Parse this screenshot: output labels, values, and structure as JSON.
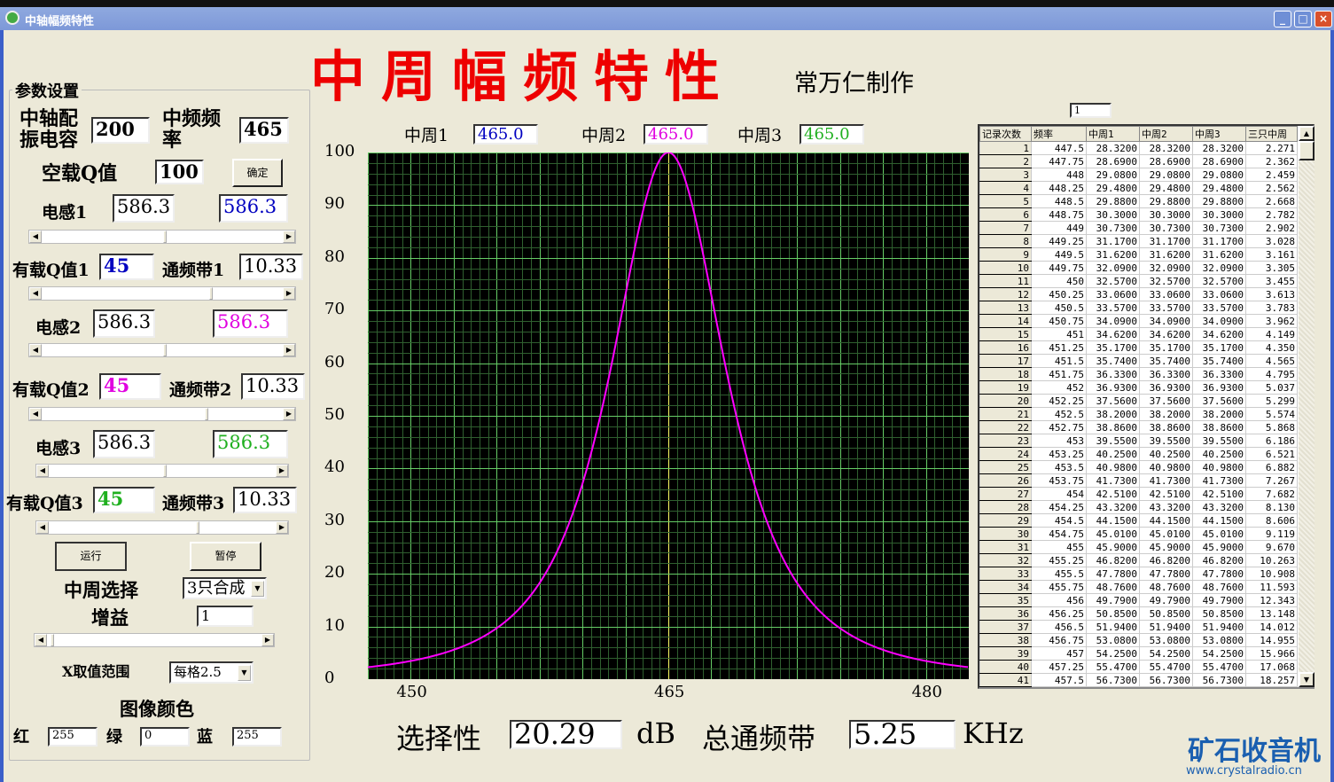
{
  "window": {
    "title": "中轴幅频特性",
    "minimize": "_",
    "maximize": "□",
    "close": "×"
  },
  "header": {
    "title": "中周幅频特性",
    "author": "常万仁制作"
  },
  "params": {
    "group_title": "参数设置",
    "cap_label": "中轴配振电容",
    "cap_value": "200",
    "if_label": "中频频率",
    "if_value": "465",
    "q0_label": "空载Q值",
    "q0_value": "100",
    "confirm_button": "确定",
    "stages": [
      {
        "l_label": "电感1",
        "l_value": "586.3",
        "l_value2": "586.3",
        "q_label": "有载Q值1",
        "q_value": "45",
        "bw_label": "通频带1",
        "bw_value": "10.33",
        "color": "#0000c0"
      },
      {
        "l_label": "电感2",
        "l_value": "586.3",
        "l_value2": "586.3",
        "q_label": "有载Q值2",
        "q_value": "45",
        "bw_label": "通频带2",
        "bw_value": "10.33",
        "color": "#e000e0"
      },
      {
        "l_label": "电感3",
        "l_value": "586.3",
        "l_value2": "586.3",
        "q_label": "有载Q值3",
        "q_value": "45",
        "bw_label": "通频带3",
        "bw_value": "10.33",
        "color": "#20b020"
      }
    ],
    "run_button": "运行",
    "pause_button": "暂停",
    "select_label": "中周选择",
    "select_value": "3只合成",
    "gain_label": "增益",
    "gain_value": "1",
    "xrange_label": "X取值范围",
    "xrange_value": "每格2.5",
    "color_label": "图像颜色",
    "red_label": "红",
    "red_value": "255",
    "green_label": "绿",
    "green_value": "0",
    "blue_label": "蓝",
    "blue_value": "255"
  },
  "chart_header": [
    {
      "label": "中周1",
      "value": "465.0",
      "color": "#0000c0"
    },
    {
      "label": "中周2",
      "value": "465.0",
      "color": "#e000e0"
    },
    {
      "label": "中周3",
      "value": "465.0",
      "color": "#20b020"
    }
  ],
  "chart_data": {
    "type": "line",
    "title": "",
    "xlabel": "",
    "ylabel": "",
    "xlim": [
      447.5,
      482.5
    ],
    "ylim": [
      0,
      100
    ],
    "xticks": [
      "450",
      "465",
      "480"
    ],
    "xtick_values": [
      450,
      465,
      480
    ],
    "yticks": [
      "100",
      "90",
      "80",
      "70",
      "60",
      "50",
      "40",
      "30",
      "20",
      "10",
      "0"
    ],
    "grid": true,
    "series": [
      {
        "name": "三只中周",
        "color": "#ff00ff",
        "model": "3-stage resonance",
        "f0": 465,
        "q": 45,
        "stages": 3
      }
    ]
  },
  "record_box": "1",
  "table": {
    "headers": [
      "记录次数",
      "频率",
      "中周1",
      "中周2",
      "中周3",
      "三只中周"
    ],
    "rows": [
      [
        "1",
        "447.5",
        "28.3200",
        "28.3200",
        "28.3200",
        "2.271"
      ],
      [
        "2",
        "447.75",
        "28.6900",
        "28.6900",
        "28.6900",
        "2.362"
      ],
      [
        "3",
        "448",
        "29.0800",
        "29.0800",
        "29.0800",
        "2.459"
      ],
      [
        "4",
        "448.25",
        "29.4800",
        "29.4800",
        "29.4800",
        "2.562"
      ],
      [
        "5",
        "448.5",
        "29.8800",
        "29.8800",
        "29.8800",
        "2.668"
      ],
      [
        "6",
        "448.75",
        "30.3000",
        "30.3000",
        "30.3000",
        "2.782"
      ],
      [
        "7",
        "449",
        "30.7300",
        "30.7300",
        "30.7300",
        "2.902"
      ],
      [
        "8",
        "449.25",
        "31.1700",
        "31.1700",
        "31.1700",
        "3.028"
      ],
      [
        "9",
        "449.5",
        "31.6200",
        "31.6200",
        "31.6200",
        "3.161"
      ],
      [
        "10",
        "449.75",
        "32.0900",
        "32.0900",
        "32.0900",
        "3.305"
      ],
      [
        "11",
        "450",
        "32.5700",
        "32.5700",
        "32.5700",
        "3.455"
      ],
      [
        "12",
        "450.25",
        "33.0600",
        "33.0600",
        "33.0600",
        "3.613"
      ],
      [
        "13",
        "450.5",
        "33.5700",
        "33.5700",
        "33.5700",
        "3.783"
      ],
      [
        "14",
        "450.75",
        "34.0900",
        "34.0900",
        "34.0900",
        "3.962"
      ],
      [
        "15",
        "451",
        "34.6200",
        "34.6200",
        "34.6200",
        "4.149"
      ],
      [
        "16",
        "451.25",
        "35.1700",
        "35.1700",
        "35.1700",
        "4.350"
      ],
      [
        "17",
        "451.5",
        "35.7400",
        "35.7400",
        "35.7400",
        "4.565"
      ],
      [
        "18",
        "451.75",
        "36.3300",
        "36.3300",
        "36.3300",
        "4.795"
      ],
      [
        "19",
        "452",
        "36.9300",
        "36.9300",
        "36.9300",
        "5.037"
      ],
      [
        "20",
        "452.25",
        "37.5600",
        "37.5600",
        "37.5600",
        "5.299"
      ],
      [
        "21",
        "452.5",
        "38.2000",
        "38.2000",
        "38.2000",
        "5.574"
      ],
      [
        "22",
        "452.75",
        "38.8600",
        "38.8600",
        "38.8600",
        "5.868"
      ],
      [
        "23",
        "453",
        "39.5500",
        "39.5500",
        "39.5500",
        "6.186"
      ],
      [
        "24",
        "453.25",
        "40.2500",
        "40.2500",
        "40.2500",
        "6.521"
      ],
      [
        "25",
        "453.5",
        "40.9800",
        "40.9800",
        "40.9800",
        "6.882"
      ],
      [
        "26",
        "453.75",
        "41.7300",
        "41.7300",
        "41.7300",
        "7.267"
      ],
      [
        "27",
        "454",
        "42.5100",
        "42.5100",
        "42.5100",
        "7.682"
      ],
      [
        "28",
        "454.25",
        "43.3200",
        "43.3200",
        "43.3200",
        "8.130"
      ],
      [
        "29",
        "454.5",
        "44.1500",
        "44.1500",
        "44.1500",
        "8.606"
      ],
      [
        "30",
        "454.75",
        "45.0100",
        "45.0100",
        "45.0100",
        "9.119"
      ],
      [
        "31",
        "455",
        "45.9000",
        "45.9000",
        "45.9000",
        "9.670"
      ],
      [
        "32",
        "455.25",
        "46.8200",
        "46.8200",
        "46.8200",
        "10.263"
      ],
      [
        "33",
        "455.5",
        "47.7800",
        "47.7800",
        "47.7800",
        "10.908"
      ],
      [
        "34",
        "455.75",
        "48.7600",
        "48.7600",
        "48.7600",
        "11.593"
      ],
      [
        "35",
        "456",
        "49.7900",
        "49.7900",
        "49.7900",
        "12.343"
      ],
      [
        "36",
        "456.25",
        "50.8500",
        "50.8500",
        "50.8500",
        "13.148"
      ],
      [
        "37",
        "456.5",
        "51.9400",
        "51.9400",
        "51.9400",
        "14.012"
      ],
      [
        "38",
        "456.75",
        "53.0800",
        "53.0800",
        "53.0800",
        "14.955"
      ],
      [
        "39",
        "457",
        "54.2500",
        "54.2500",
        "54.2500",
        "15.966"
      ],
      [
        "40",
        "457.25",
        "55.4700",
        "55.4700",
        "55.4700",
        "17.068"
      ],
      [
        "41",
        "457.5",
        "56.7300",
        "56.7300",
        "56.7300",
        "18.257"
      ]
    ]
  },
  "bottom": {
    "selectivity_label": "选择性",
    "selectivity_value": "20.29",
    "db_unit": "dB",
    "bw_label": "总通频带",
    "bw_value": "5.25",
    "khz_unit": "KHz"
  },
  "watermark": {
    "text": "矿石收音机",
    "url": "www.crystalradio.cn"
  }
}
